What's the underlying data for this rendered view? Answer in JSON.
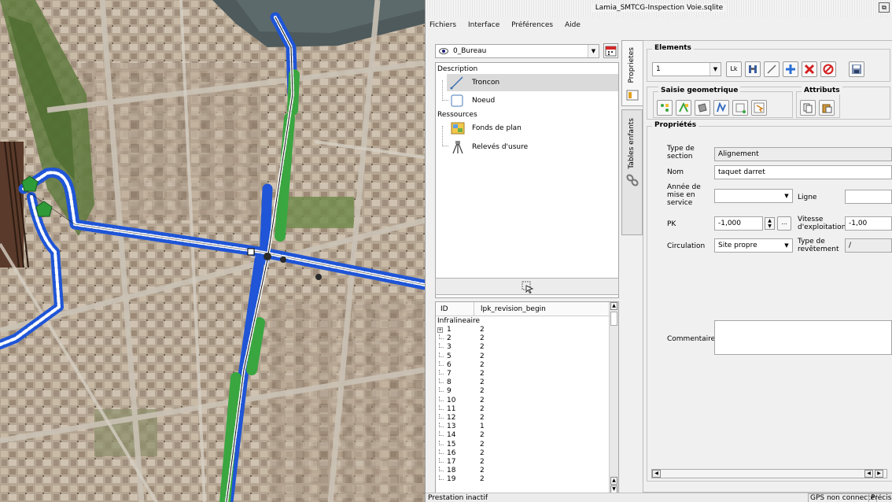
{
  "window": {
    "title": "Lamia_SMTCG-Inspection Voie.sqlite",
    "restore_glyph": "⧉"
  },
  "menu": {
    "items": [
      "Fichiers",
      "Interface",
      "Préférences",
      "Aide"
    ]
  },
  "layer_selector": {
    "value": "0_Bureau"
  },
  "tree": {
    "description_label": "Description",
    "troncon_label": "Troncon",
    "noeud_label": "Noeud",
    "ressources_label": "Ressources",
    "fonds_label": "Fonds de plan",
    "releves_label": "Relevés d'usure"
  },
  "table": {
    "headers": {
      "id": "ID",
      "rev": "lpk_revision_begin"
    },
    "group_label": "Infralineaire",
    "rows": [
      {
        "id": "1",
        "rev": "2"
      },
      {
        "id": "2",
        "rev": "2"
      },
      {
        "id": "3",
        "rev": "2"
      },
      {
        "id": "5",
        "rev": "2"
      },
      {
        "id": "6",
        "rev": "2"
      },
      {
        "id": "7",
        "rev": "2"
      },
      {
        "id": "8",
        "rev": "2"
      },
      {
        "id": "9",
        "rev": "2"
      },
      {
        "id": "10",
        "rev": "2"
      },
      {
        "id": "11",
        "rev": "2"
      },
      {
        "id": "12",
        "rev": "2"
      },
      {
        "id": "13",
        "rev": "1"
      },
      {
        "id": "14",
        "rev": "2"
      },
      {
        "id": "15",
        "rev": "2"
      },
      {
        "id": "16",
        "rev": "2"
      },
      {
        "id": "17",
        "rev": "2"
      },
      {
        "id": "18",
        "rev": "2"
      },
      {
        "id": "19",
        "rev": "2"
      }
    ]
  },
  "vtabs": {
    "proprietes": "Proprietes",
    "tables_enfants": "Tables enfants"
  },
  "elements": {
    "title": "Elements",
    "selector_value": "1",
    "lk_label": "Lk"
  },
  "saisie": {
    "title": "Saisie geometrique"
  },
  "attributs": {
    "title": "Attributs"
  },
  "proprietes": {
    "title": "Propriétés",
    "type_section_label": "Type de section",
    "type_section_value": "Alignement",
    "nom_label": "Nom",
    "nom_value": "taquet darret",
    "annee_label": "Année de mise en service",
    "annee_value": "",
    "ligne_label": "Ligne",
    "ligne_value": "",
    "pk_label": "PK",
    "pk_value": "-1,000",
    "pk_more": "...",
    "vitesse_label": "Vitesse d'exploitation",
    "vitesse_value": "-1,00",
    "circulation_label": "Circulation",
    "circulation_value": "Site propre",
    "revetement_label": "Type de revêtement",
    "revetement_value": "/",
    "commentaire_label": "Commentaire",
    "commentaire_value": ""
  },
  "status": {
    "left": "Prestation inactif",
    "gps": "GPS non connecté",
    "precision": "Précision"
  },
  "colors": {
    "track_blue": "#1f55d6",
    "track_green": "#3aa640",
    "save_red": "#d42020",
    "add_blue": "#2a6fd6"
  }
}
